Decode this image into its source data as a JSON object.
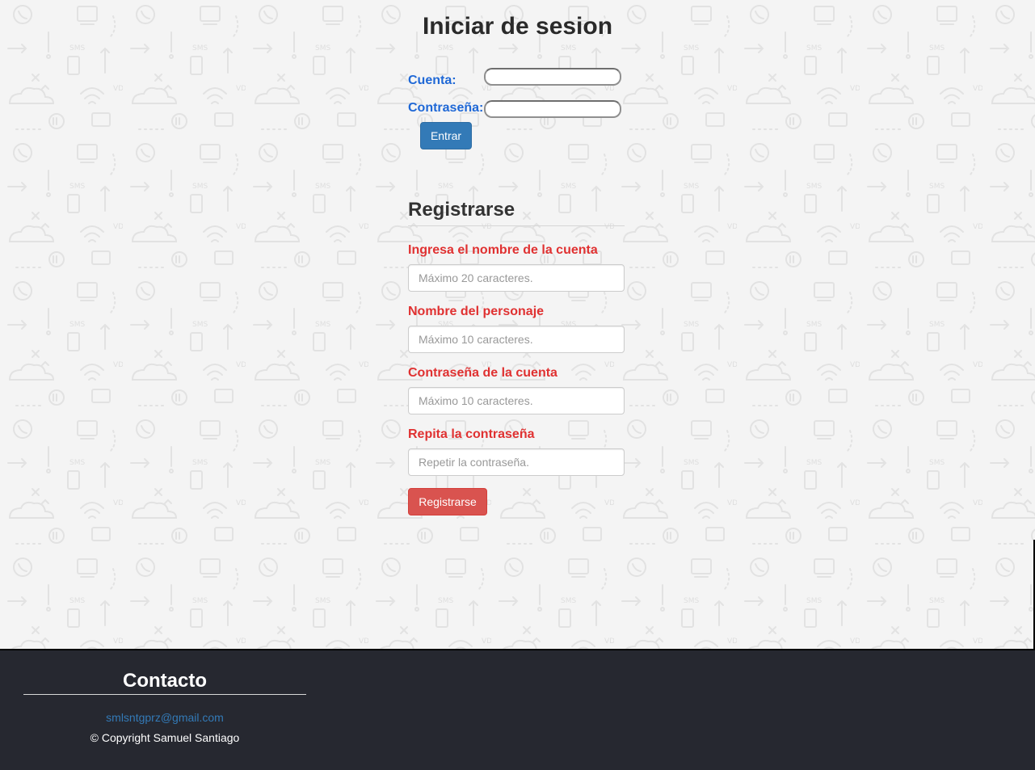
{
  "login": {
    "title": "Iniciar de sesion",
    "account_label": "Cuenta:",
    "password_label": "Contraseña:",
    "submit_label": "Entrar"
  },
  "register": {
    "title": "Registrarse",
    "fields": [
      {
        "label": "Ingresa el nombre de la cuenta",
        "placeholder": "Máximo 20 caracteres."
      },
      {
        "label": "Nombre del personaje",
        "placeholder": "Máximo 10 caracteres."
      },
      {
        "label": "Contraseña de la cuenta",
        "placeholder": "Máximo 10 caracteres."
      },
      {
        "label": "Repita la contraseña",
        "placeholder": "Repetir la contraseña."
      }
    ],
    "submit_label": "Registrarse"
  },
  "footer": {
    "title": "Contacto",
    "email": "smlsntgprz@gmail.com",
    "copyright": "© Copyright Samuel Santiago"
  },
  "colors": {
    "primary_button": "#337ab7",
    "danger_button": "#d9534f",
    "login_label": "#1f68d6",
    "register_label": "#e03131",
    "footer_bg": "#262830"
  },
  "background_icons": [
    "phone-icon",
    "monitor-icon",
    "wifi-icon",
    "cloud-icon",
    "chat-icon",
    "mic-icon",
    "envelope-icon",
    "star-icon",
    "arrow-icon"
  ]
}
